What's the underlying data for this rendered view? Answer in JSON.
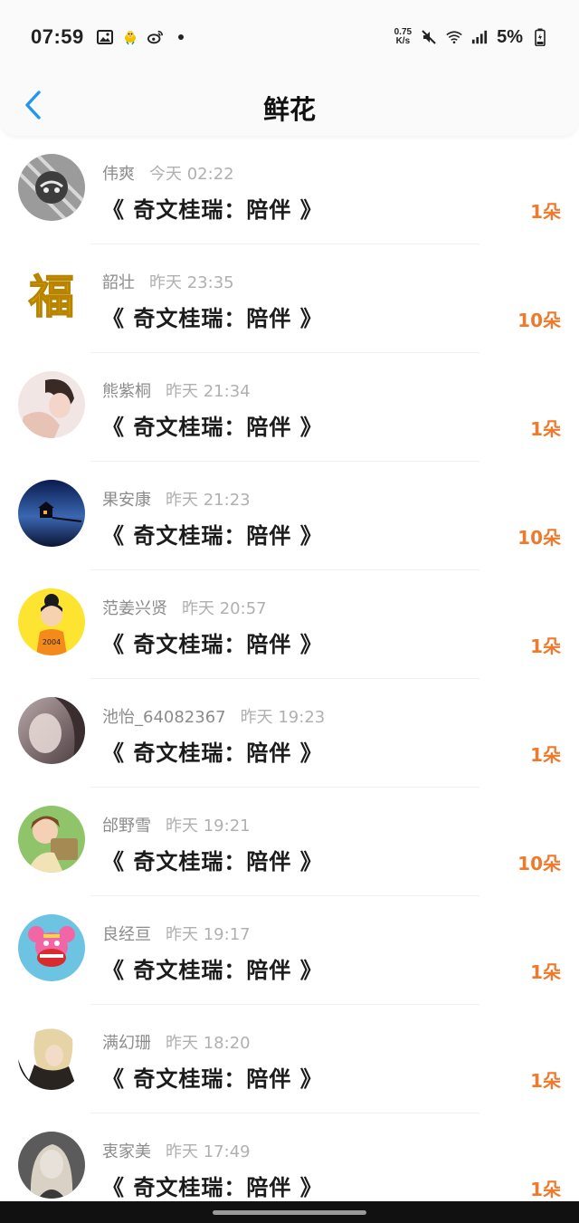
{
  "status": {
    "time": "07:59",
    "net_speed_top": "0.75",
    "net_speed_bottom": "K/s",
    "battery": "5%",
    "left_icons": [
      "gallery-icon",
      "bird-icon",
      "weibo-icon",
      "dot-icon"
    ],
    "right_icons": [
      "mute-icon",
      "wifi-icon",
      "signal-icon",
      "battery-icon"
    ]
  },
  "header": {
    "title": "鲜花",
    "back_icon": "chevron-left-icon"
  },
  "colors": {
    "accent": "#ee7a2c",
    "back": "#2196f3"
  },
  "items": [
    {
      "name": "伟爽",
      "time": "今天 02:22",
      "book": "《 奇文桂瑞：陪伴 》",
      "count": "1朵"
    },
    {
      "name": "韶壮",
      "time": "昨天 23:35",
      "book": "《 奇文桂瑞：陪伴 》",
      "count": "10朵"
    },
    {
      "name": "熊紫桐",
      "time": "昨天 21:34",
      "book": "《 奇文桂瑞：陪伴 》",
      "count": "1朵"
    },
    {
      "name": "果安康",
      "time": "昨天 21:23",
      "book": "《 奇文桂瑞：陪伴 》",
      "count": "10朵"
    },
    {
      "name": "范姜兴贤",
      "time": "昨天 20:57",
      "book": "《 奇文桂瑞：陪伴 》",
      "count": "1朵"
    },
    {
      "name": "池怡_64082367",
      "time": "昨天 19:23",
      "book": "《 奇文桂瑞：陪伴 》",
      "count": "1朵"
    },
    {
      "name": "邰野雪",
      "time": "昨天 19:21",
      "book": "《 奇文桂瑞：陪伴 》",
      "count": "10朵"
    },
    {
      "name": "良经亘",
      "time": "昨天 19:17",
      "book": "《 奇文桂瑞：陪伴 》",
      "count": "1朵"
    },
    {
      "name": "满幻珊",
      "time": "昨天 18:20",
      "book": "《 奇文桂瑞：陪伴 》",
      "count": "1朵"
    },
    {
      "name": "衷家美",
      "time": "昨天 17:49",
      "book": "《 奇文桂瑞：陪伴 》",
      "count": "1朵"
    }
  ]
}
